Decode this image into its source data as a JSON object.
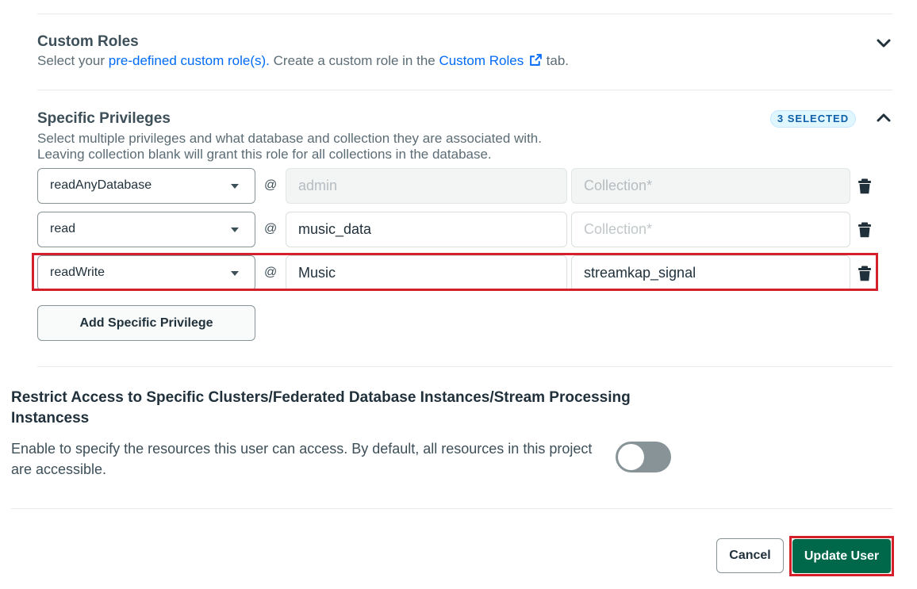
{
  "custom_roles": {
    "title": "Custom Roles",
    "desc_prefix": "Select your ",
    "link_predefined": "pre-defined custom role(s).",
    "desc_middle": " Create a custom role in the ",
    "link_custom_roles": "Custom Roles",
    "desc_suffix": " tab."
  },
  "specific_privileges": {
    "title": "Specific Privileges",
    "badge": "3 SELECTED",
    "desc_line1": "Select multiple privileges and what database and collection they are associated with.",
    "desc_line2": "Leaving collection blank will grant this role for all collections in the database.",
    "rows": [
      {
        "role": "readAnyDatabase",
        "at": "@",
        "database": "admin",
        "collection": "Collection*"
      },
      {
        "role": "read",
        "at": "@",
        "database": "music_data",
        "collection": "Collection*"
      },
      {
        "role": "readWrite",
        "at": "@",
        "database": "Music",
        "collection": "streamkap_signal"
      }
    ],
    "add_button": "Add Specific Privilege"
  },
  "restrict_access": {
    "title": "Restrict Access to Specific Clusters/Federated Database Instances/Stream Processing Instancess",
    "desc": "Enable to specify the resources this user can access. By default, all resources in this project are accessible.",
    "toggle_on": false
  },
  "footer": {
    "cancel": "Cancel",
    "update": "Update User"
  },
  "colors": {
    "accent_link": "#016bf8",
    "primary_button": "#00684a",
    "highlight": "#d3202b"
  }
}
